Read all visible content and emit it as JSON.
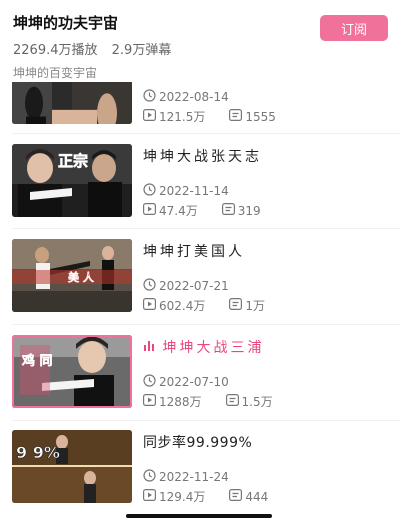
{
  "header": {
    "title": "坤坤的功夫宇宙",
    "plays": "2269.4万播放",
    "danmaku": "2.9万弹幕",
    "subscribe_label": "订阅",
    "description": "坤坤的百变宇宙"
  },
  "colors": {
    "accent": "#f0719a",
    "active_title": "#e8487f"
  },
  "videos": [
    {
      "title": "",
      "date": "2022-08-14",
      "plays": "121.5万",
      "comments": "1555",
      "overlay_text": ""
    },
    {
      "title": "坤坤大战张天志",
      "date": "2022-11-14",
      "plays": "47.4万",
      "comments": "319",
      "overlay_text": "正宗"
    },
    {
      "title": "坤坤打美国人",
      "date": "2022-07-21",
      "plays": "602.4万",
      "comments": "1万",
      "overlay_text": "美  人"
    },
    {
      "title": "坤坤大战三浦",
      "date": "2022-07-10",
      "plays": "1288万",
      "comments": "1.5万",
      "overlay_text": "鸡 同",
      "playing": true
    },
    {
      "title": "同步率99.999%",
      "date": "2022-11-24",
      "plays": "129.4万",
      "comments": "444",
      "overlay_text": "9 9%"
    }
  ]
}
